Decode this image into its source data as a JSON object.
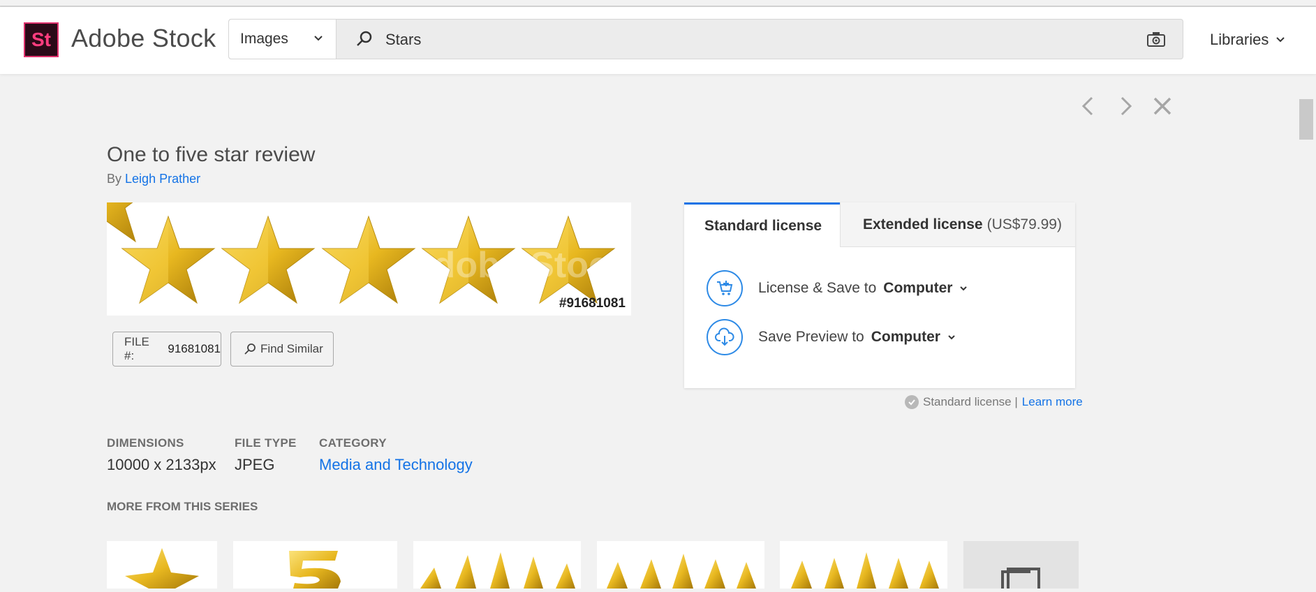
{
  "header": {
    "logo_text": "St",
    "brand_name": "Adobe Stock",
    "search_type": "Images",
    "search_value": "Stars",
    "libraries_label": "Libraries"
  },
  "asset": {
    "title": "One to five star review",
    "by_label": "By",
    "author": "Leigh Prather",
    "watermark": "Adobe Stock",
    "preview_id": "#91681081",
    "file_label": "FILE #:",
    "file_number": "91681081",
    "find_similar_label": "Find Similar"
  },
  "license": {
    "tab_standard": "Standard license",
    "tab_extended": "Extended license",
    "tab_extended_price": "(US$79.99)",
    "actions": [
      {
        "label": "License & Save to",
        "target": "Computer",
        "icon": "cart-plus-icon"
      },
      {
        "label": "Save Preview to",
        "target": "Computer",
        "icon": "cloud-download-icon"
      }
    ],
    "note_text": "Standard license |",
    "learn_more": "Learn more"
  },
  "meta": {
    "dimensions_label": "DIMENSIONS",
    "dimensions_value": "10000 x 2133px",
    "filetype_label": "FILE TYPE",
    "filetype_value": "JPEG",
    "category_label": "CATEGORY",
    "category_value": "Media and Technology"
  },
  "series": {
    "title": "MORE FROM THIS SERIES"
  },
  "colors": {
    "accent": "#1473e6",
    "star_gold": "#e8b820",
    "logo_bg": "#2b0a18",
    "logo_pink": "#ff3d7f"
  }
}
